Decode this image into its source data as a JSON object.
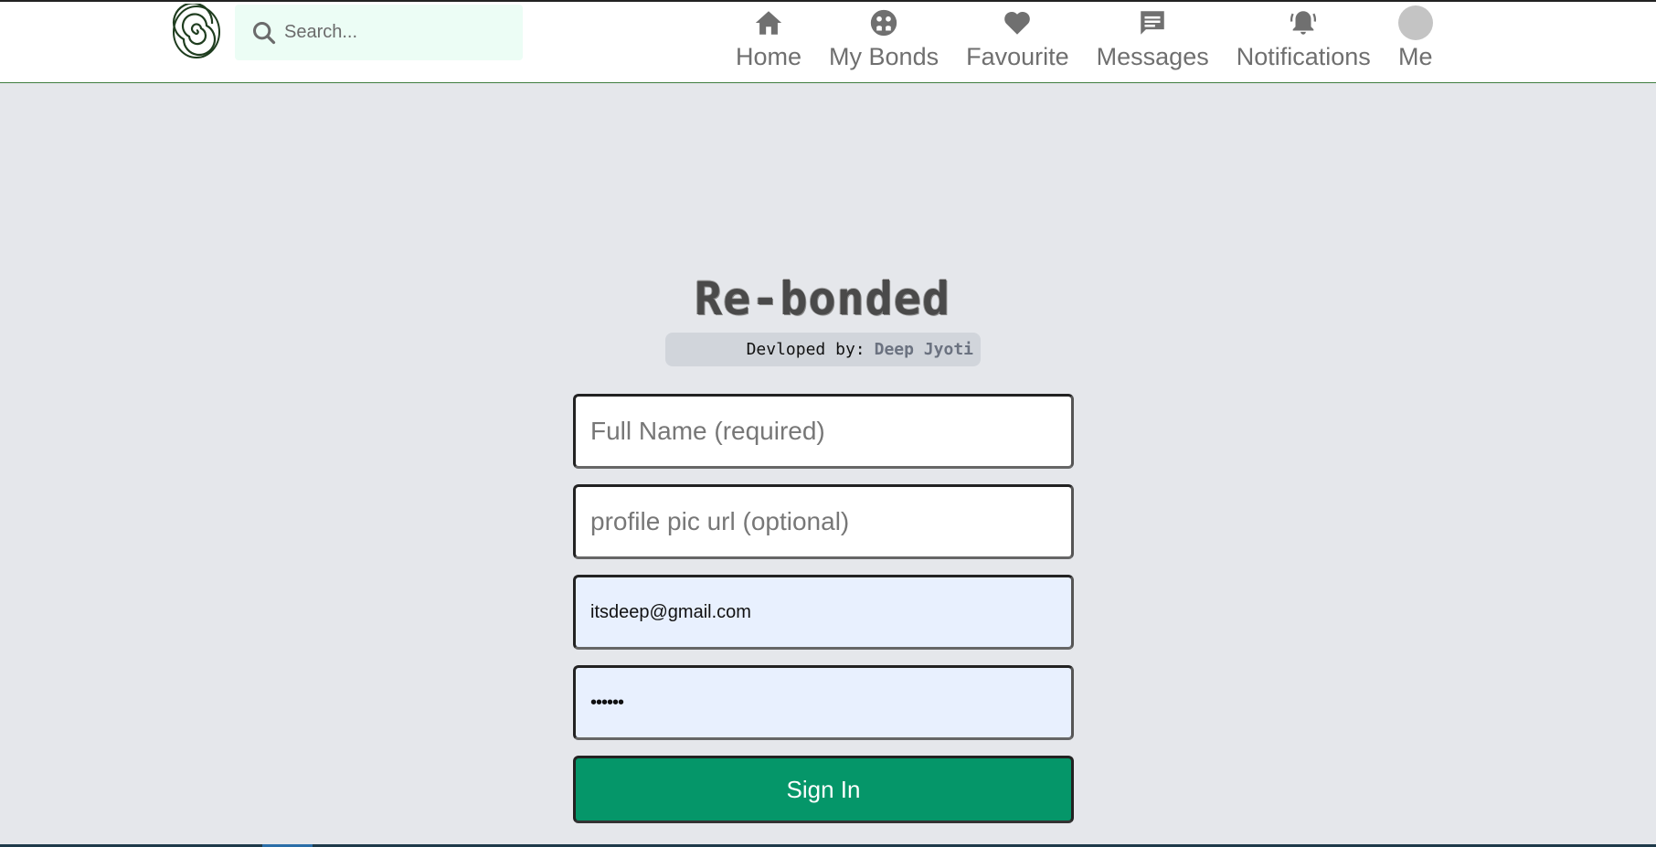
{
  "header": {
    "search": {
      "placeholder": "Search..."
    },
    "nav": [
      {
        "label": "Home",
        "icon": "home-icon"
      },
      {
        "label": "My Bonds",
        "icon": "bonds-icon"
      },
      {
        "label": "Favourite",
        "icon": "heart-icon"
      },
      {
        "label": "Messages",
        "icon": "message-icon"
      },
      {
        "label": "Notifications",
        "icon": "bell-icon"
      },
      {
        "label": "Me",
        "icon": "avatar"
      }
    ]
  },
  "brand": {
    "title": "Re-bonded",
    "developed_by_label": "Devloped by:",
    "developer_name": "Deep Jyoti"
  },
  "form": {
    "full_name": {
      "placeholder": "Full Name (required)",
      "value": ""
    },
    "profile_pic": {
      "placeholder": "profile pic url (optional)",
      "value": ""
    },
    "email": {
      "value": "itsdeep@gmail.com"
    },
    "password": {
      "value": "••••••"
    },
    "submit_label": "Sign In"
  },
  "colors": {
    "header_bg": "#ffffff",
    "page_bg": "#e5e7eb",
    "search_bg": "#ecfdf5",
    "primary_button": "#059669",
    "autofill_bg": "#e8f0fe",
    "nav_text": "#6f6f6f"
  }
}
